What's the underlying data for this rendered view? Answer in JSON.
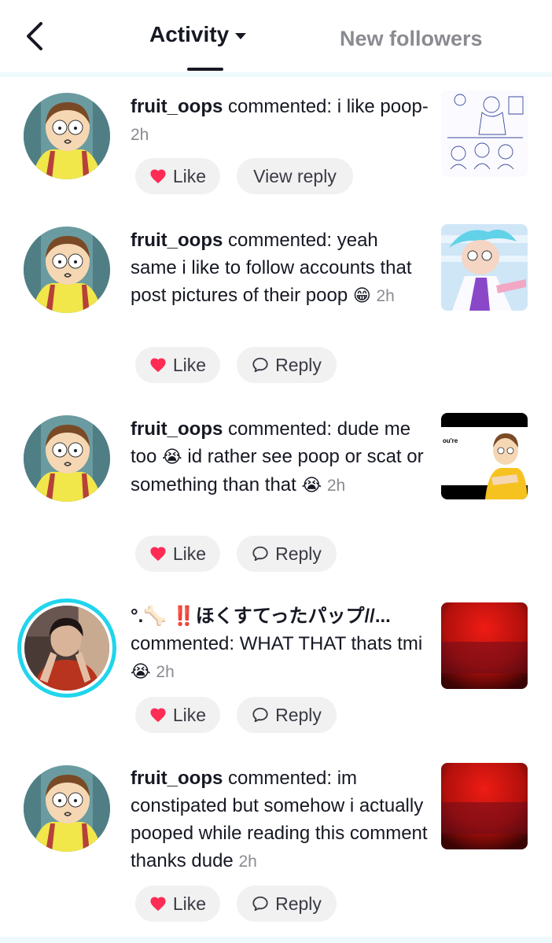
{
  "header": {
    "tab_activity": "Activity",
    "tab_new_followers": "New followers"
  },
  "notifications": [
    {
      "username": "fruit_oops",
      "text": " commented: i like poop-",
      "time": "2h",
      "like_label": "Like",
      "action_label": "View reply",
      "avatar_icon": "morty-avatar",
      "thumb": "sketch-thumbnail"
    },
    {
      "username": "fruit_oops",
      "text": " commented: yeah same i like to follow accounts that post pictures of their poop",
      "emoji": "😁",
      "time": "2h",
      "like_label": "Like",
      "action_label": "Reply",
      "avatar_icon": "morty-avatar",
      "thumb": "rick-art-thumbnail"
    },
    {
      "username": "fruit_oops",
      "text_before": " commented: dude me too",
      "emoji_mid": "😭",
      "text_after": " id rather see poop or scat or something than that",
      "emoji": "😭",
      "time": "2h",
      "like_label": "Like",
      "action_label": "Reply",
      "avatar_icon": "morty-avatar",
      "thumb": "morty-cartoon-thumbnail",
      "thumb_text": "ou're"
    },
    {
      "username": "°.🦴 ‼️ほくすてったパップ//...",
      "text": "commented: WHAT THAT thats tmi",
      "emoji": "😭",
      "time": "2h",
      "like_label": "Like",
      "action_label": "Reply",
      "avatar_icon": "photo-avatar",
      "thumb": "red-thumbnail"
    },
    {
      "username": "fruit_oops",
      "text": " commented: im constipated but somehow i actually pooped while reading this comment thanks dude",
      "time": "2h",
      "like_label": "Like",
      "action_label": "Reply",
      "avatar_icon": "morty-avatar",
      "thumb": "red-thumbnail"
    }
  ],
  "colors": {
    "heart": "#fe2c55",
    "ring": "#20d5ec",
    "button_bg": "#f1f1f2",
    "muted_text": "#8a8b91"
  }
}
